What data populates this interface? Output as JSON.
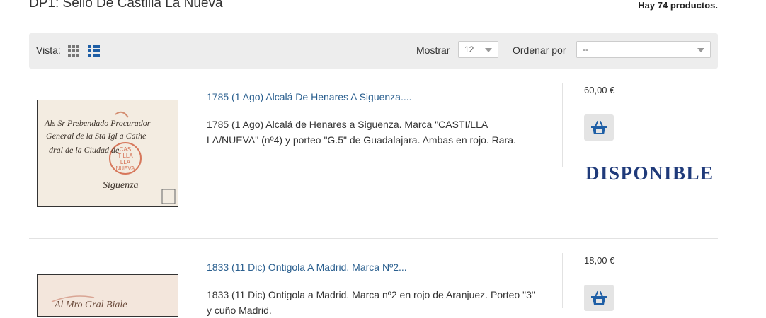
{
  "header": {
    "title": "DP1: Sello De Castilla La Nueva",
    "count": "Hay 74 productos."
  },
  "toolbar": {
    "view_label": "Vista:",
    "grid_icon": "grid-view-icon",
    "list_icon": "list-view-icon",
    "show_label": "Mostrar",
    "show_value": "12",
    "sort_label": "Ordenar por",
    "sort_value": "--"
  },
  "colors": {
    "link": "#2a5f8f",
    "toolbar_bg": "#ededed",
    "available": "#1f3a7a",
    "cart_icon": "#1f5fa6"
  },
  "products": [
    {
      "title": "1785 (1 Ago) Alcalá De Henares A Siguenza....",
      "description": "1785 (1 Ago) Alcalá de Henares a Siguenza. Marca \"CASTI/LLA LA/NUEVA\" (nº4) y porteo \"G.5\" de Guadalajara. Ambas en rojo. Rara.",
      "price": "60,00 €",
      "availability": "DISPONIBLE",
      "image": {
        "line1": "Als Sr Prebendado Procurador",
        "line2": "General de la Sta Igl a Cathe",
        "line3": "dral de la Ciudad de",
        "stamp": [
          "CAS",
          "TILLA",
          "LLA",
          "NUEVA"
        ],
        "city": "Siguenza"
      }
    },
    {
      "title": "1833 (11 Dic) Ontigola A Madrid. Marca Nº2...",
      "description": "1833 (11 Dic) Ontigola a Madrid. Marca nº2 en rojo de Aranjuez. Porteo \"3\" y cuño Madrid.",
      "price": "18,00 €",
      "image": {
        "line1": "Al Mro Gral Biale"
      }
    }
  ]
}
